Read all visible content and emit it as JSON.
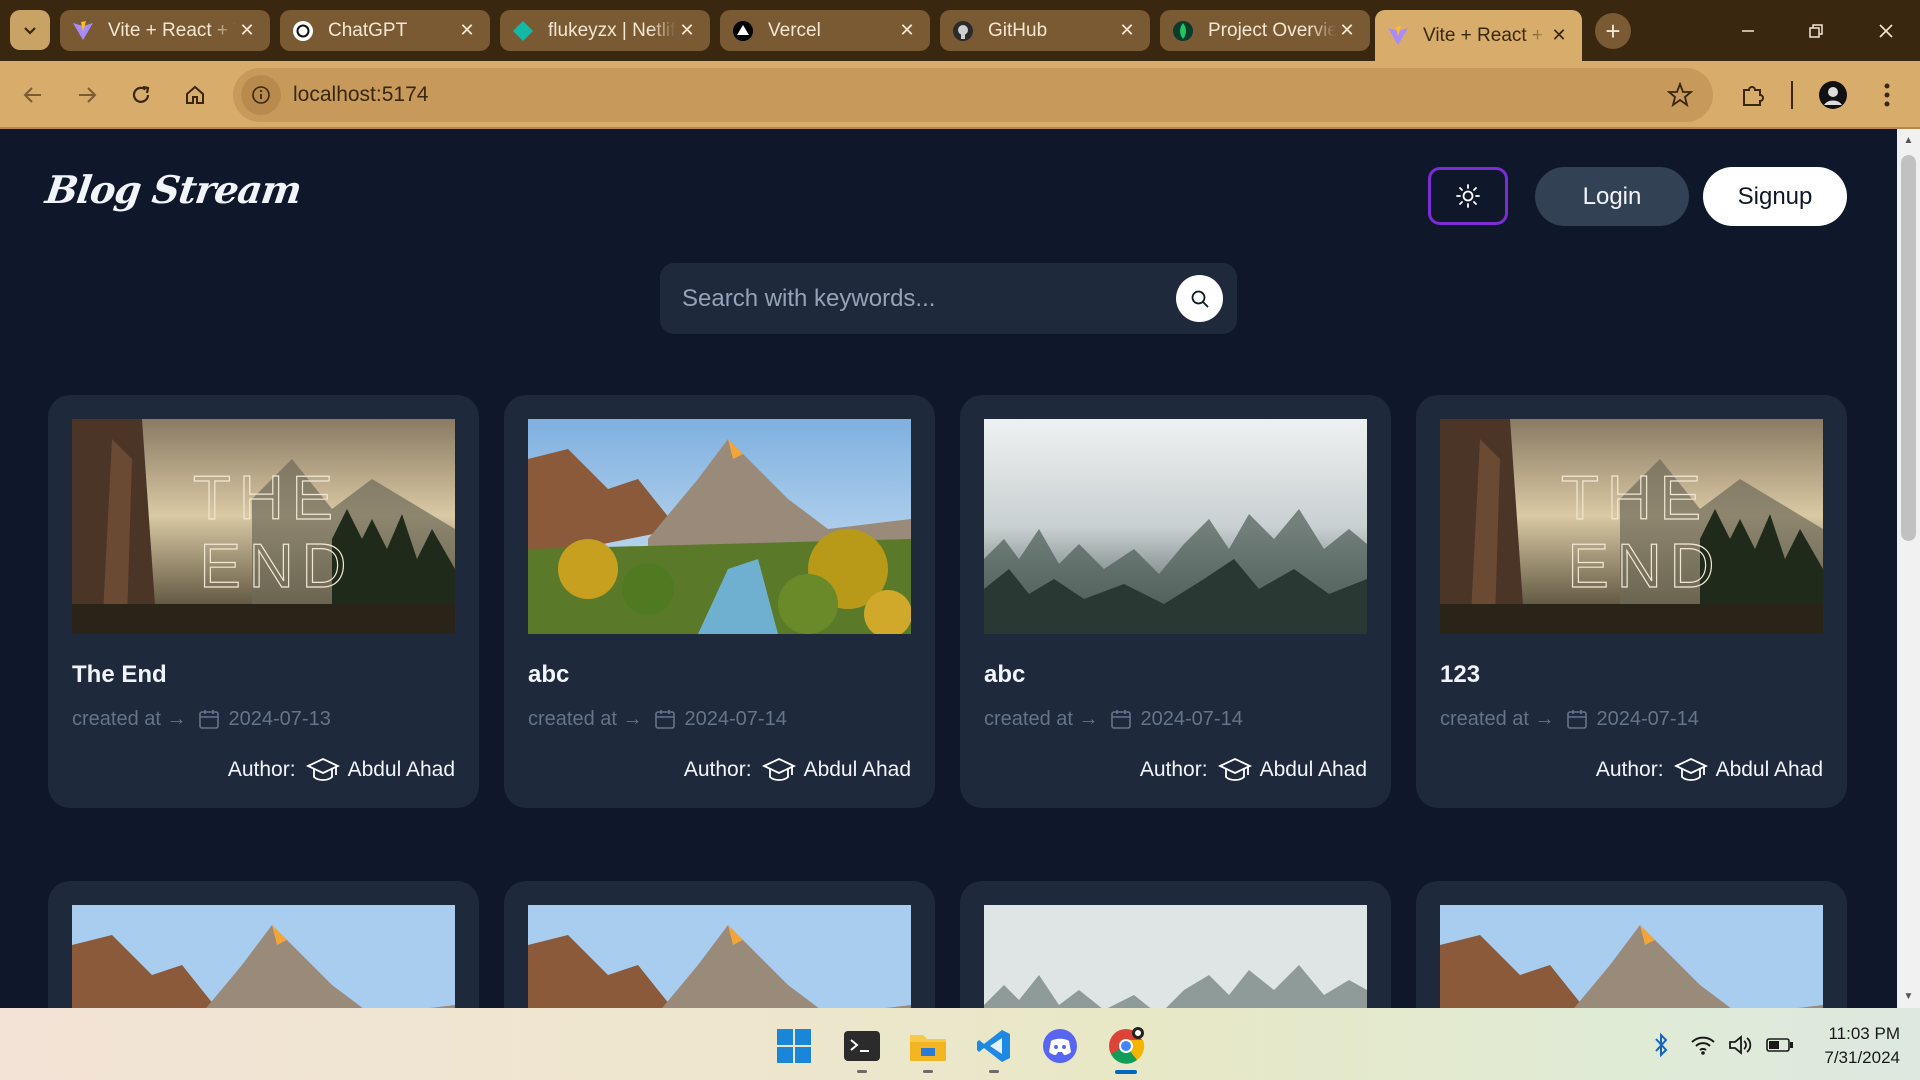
{
  "browser": {
    "tabs": [
      {
        "title": "Vite + React + TS",
        "icon": "vite-icon",
        "active": false
      },
      {
        "title": "ChatGPT",
        "icon": "chatgpt-icon",
        "active": false
      },
      {
        "title": "flukeyzx | Netlify",
        "icon": "netlify-icon",
        "active": false
      },
      {
        "title": "Vercel",
        "icon": "vercel-icon",
        "active": false
      },
      {
        "title": "GitHub",
        "icon": "github-icon",
        "active": false
      },
      {
        "title": "Project Overview",
        "icon": "mongodb-icon",
        "active": false
      },
      {
        "title": "Vite + React + TS",
        "icon": "vite-icon",
        "active": true
      }
    ],
    "address": "localhost:5174"
  },
  "app": {
    "logo": "Blog Stream",
    "login_label": "Login",
    "signup_label": "Signup",
    "search_placeholder": "Search with keywords..."
  },
  "posts": [
    {
      "title": "The End",
      "created_label": "created at →",
      "date": "2024-07-13",
      "author_label": "Author:",
      "author": "Abdul Ahad",
      "image": "the-end-landscape"
    },
    {
      "title": "abc",
      "created_label": "created at →",
      "date": "2024-07-14",
      "author_label": "Author:",
      "author": "Abdul Ahad",
      "image": "zion-canyon"
    },
    {
      "title": "abc",
      "created_label": "created at →",
      "date": "2024-07-14",
      "author_label": "Author:",
      "author": "Abdul Ahad",
      "image": "misty-forest"
    },
    {
      "title": "123",
      "created_label": "created at →",
      "date": "2024-07-14",
      "author_label": "Author:",
      "author": "Abdul Ahad",
      "image": "the-end-landscape"
    }
  ],
  "posts_row2_images": [
    "zion-canyon",
    "zion-canyon",
    "misty-forest",
    "zion-canyon"
  ],
  "taskbar": {
    "time": "11:03 PM",
    "date": "7/31/2024"
  },
  "colors": {
    "page_bg": "#0f172a",
    "card_bg": "#1e293b",
    "theme_border": "#7c2dd4",
    "browser_frame": "#d8ad6c"
  }
}
